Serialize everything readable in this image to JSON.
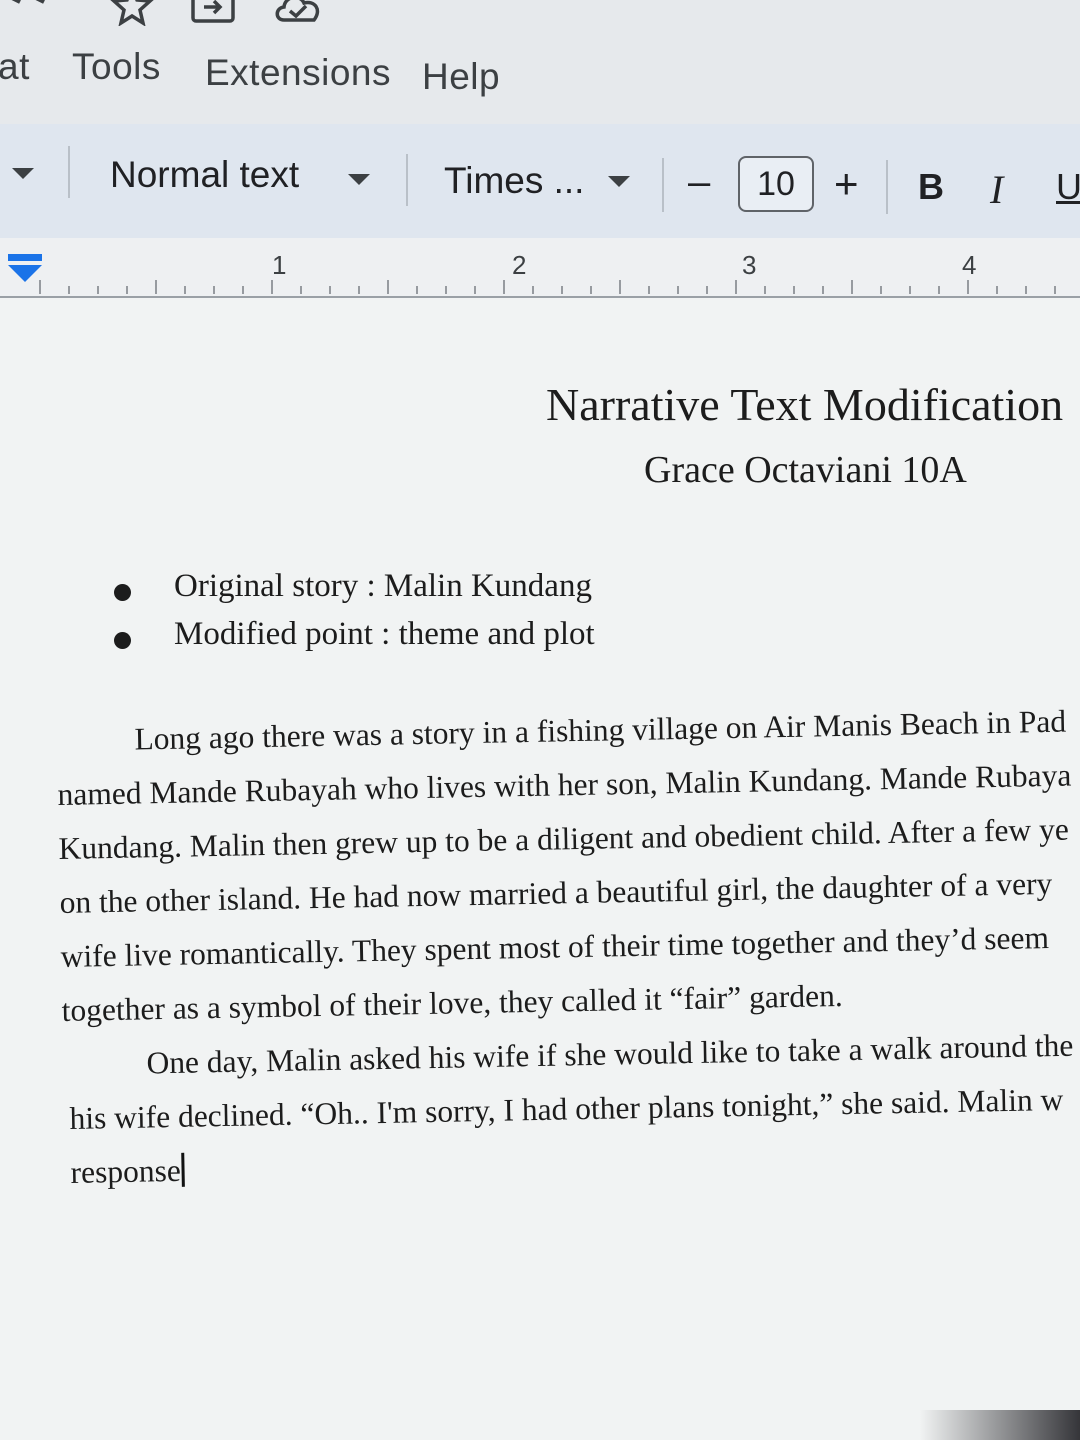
{
  "menu": {
    "items": [
      {
        "label": "at"
      },
      {
        "label": "Tools"
      },
      {
        "label": "Extensions"
      },
      {
        "label": "Help"
      }
    ]
  },
  "toolbar": {
    "style": "Normal text",
    "font": "Times ...",
    "font_size": "10",
    "minus": "–",
    "plus": "+",
    "bold": "B",
    "italic": "I",
    "underline": "U"
  },
  "ruler": {
    "numbers": [
      "1",
      "2",
      "3",
      "4"
    ]
  },
  "document": {
    "title": "Narrative Text Modification",
    "author": "Grace Octaviani 10A",
    "bullets": [
      "Original story : Malin Kundang",
      "Modified point : theme and plot"
    ],
    "paragraph1": [
      "Long ago there was a story in a fishing village on Air Manis Beach in Pad",
      "named Mande Rubayah who lives with her son, Malin Kundang. Mande Rubaya",
      "Kundang. Malin then grew up to be a diligent and obedient child. After a few ye",
      "on the other island. He had now married a beautiful girl, the daughter of a very",
      "wife live romantically. They spent most of their time together and they’d seem",
      "together as a symbol of their love, they called it “fair” garden."
    ],
    "paragraph2": [
      "One day, Malin asked his wife if she would like to take a walk around the",
      "his wife declined. “Oh.. I'm sorry, I had other plans tonight,” she said. Malin w",
      "response"
    ]
  },
  "colors": {
    "page": "#f1f3f3",
    "toolbar": "#dfe6ef",
    "accent": "#1a73e8"
  }
}
